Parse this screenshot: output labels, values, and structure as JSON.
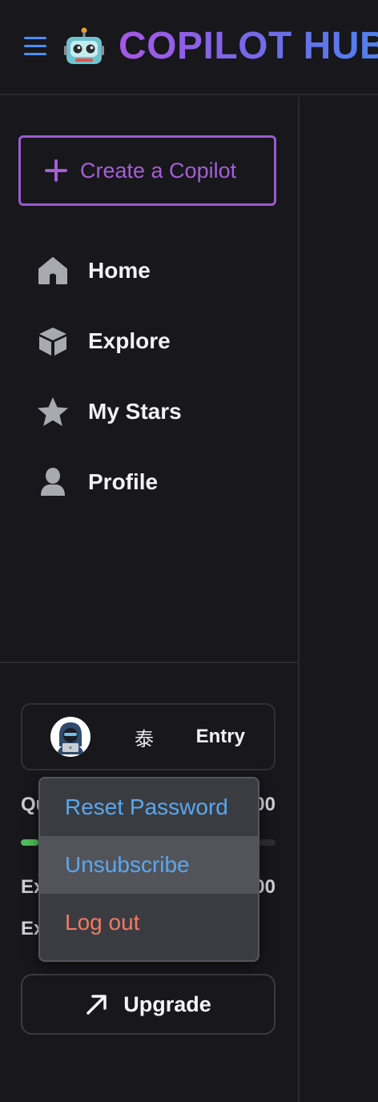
{
  "header": {
    "brand": "COPILOT HUB",
    "menu_icon": "hamburger-icon",
    "logo_icon": "robot-icon"
  },
  "sidebar": {
    "create_button": {
      "label": "Create a Copilot",
      "icon": "plus-icon"
    },
    "items": [
      {
        "label": "Home",
        "icon": "home-icon"
      },
      {
        "label": "Explore",
        "icon": "cube-icon"
      },
      {
        "label": "My Stars",
        "icon": "star-icon"
      },
      {
        "label": "Profile",
        "icon": "user-icon"
      }
    ]
  },
  "user": {
    "name": "泰",
    "plan": "Entry",
    "avatar_icon": "hacker-avatar-icon"
  },
  "stats": {
    "row1_label": "Qu",
    "row1_value": "00",
    "row2_label": "Ex",
    "row2_value": "00",
    "row3_label": "Ex"
  },
  "upgrade": {
    "label": "Upgrade",
    "icon": "arrow-up-right-icon"
  },
  "dropdown": {
    "items": [
      {
        "label": "Reset Password",
        "color": "#58a8f0"
      },
      {
        "label": "Unsubscribe",
        "color": "#58a8f0"
      },
      {
        "label": "Log out",
        "color": "#f07a62"
      }
    ]
  },
  "colors": {
    "accent_purple": "#a55fd6",
    "accent_blue": "#4b8ef5",
    "progress_green": "#4fbf5a",
    "background": "#17171c"
  }
}
